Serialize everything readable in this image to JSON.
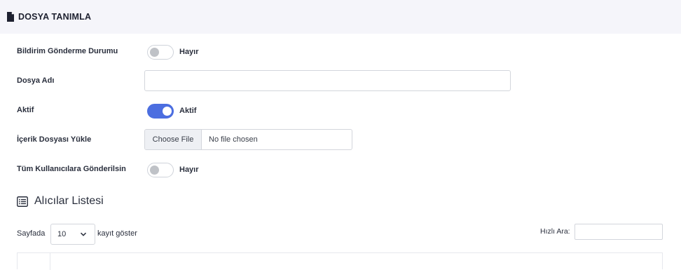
{
  "header": {
    "title": "DOSYA TANIMLA",
    "icon": "file-icon"
  },
  "form": {
    "notify": {
      "label": "Bildirim Gönderme Durumu",
      "state": "Hayır",
      "on": false
    },
    "file_name": {
      "label": "Dosya Adı",
      "value": ""
    },
    "active": {
      "label": "Aktif",
      "state": "Aktif",
      "on": true
    },
    "upload": {
      "label": "İçerik Dosyası Yükle",
      "button": "Choose File",
      "status": "No file chosen"
    },
    "send_all": {
      "label": "Tüm Kullanıcılara Gönderilsin",
      "state": "Hayır",
      "on": false
    }
  },
  "recipients": {
    "title": "Alıcılar Listesi",
    "icon": "list-icon",
    "length_prefix": "Sayfada",
    "length_value": "10",
    "length_suffix": "kayıt göster",
    "search_label": "Hızlı Ara:",
    "search_value": ""
  },
  "colors": {
    "accent": "#4c6ee0",
    "header_bg": "#f5f5fa"
  }
}
